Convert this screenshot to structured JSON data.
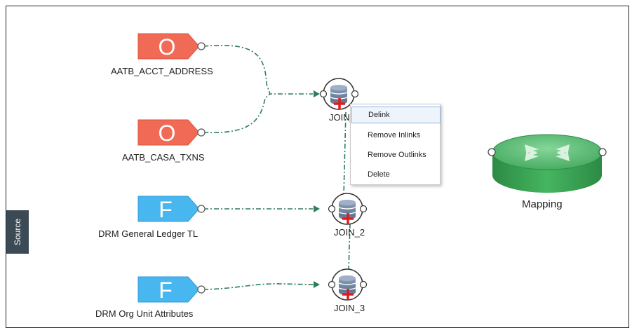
{
  "nodes": {
    "source_1": {
      "letter": "O",
      "label": "AATB_ACCT_ADDRESS",
      "color": "#f06a55"
    },
    "source_2": {
      "letter": "O",
      "label": "AATB_CASA_TXNS",
      "color": "#f06a55"
    },
    "source_3": {
      "letter": "F",
      "label": "DRM General Ledger TL",
      "color": "#49b7ef"
    },
    "source_4": {
      "letter": "F",
      "label": "DRM Org Unit Attributes",
      "color": "#49b7ef"
    }
  },
  "joins": {
    "join_1": {
      "label": "JOIN_1",
      "icon": "database-join-icon"
    },
    "join_2": {
      "label": "JOIN_2",
      "icon": "database-join-icon"
    },
    "join_3": {
      "label": "JOIN_3",
      "icon": "database-join-icon"
    }
  },
  "mapping": {
    "label": "Mapping",
    "icon": "router-mapping-icon",
    "color": "#3dae56"
  },
  "context_menu": {
    "items": [
      {
        "label": "Delink",
        "highlighted": true
      },
      {
        "label": "Remove Inlinks"
      },
      {
        "label": "Remove Outlinks"
      },
      {
        "label": "Delete"
      }
    ]
  },
  "side_tab": {
    "label": "Source"
  },
  "colors": {
    "link": "#2e7d5b",
    "join_plus": "#e01b1b"
  }
}
